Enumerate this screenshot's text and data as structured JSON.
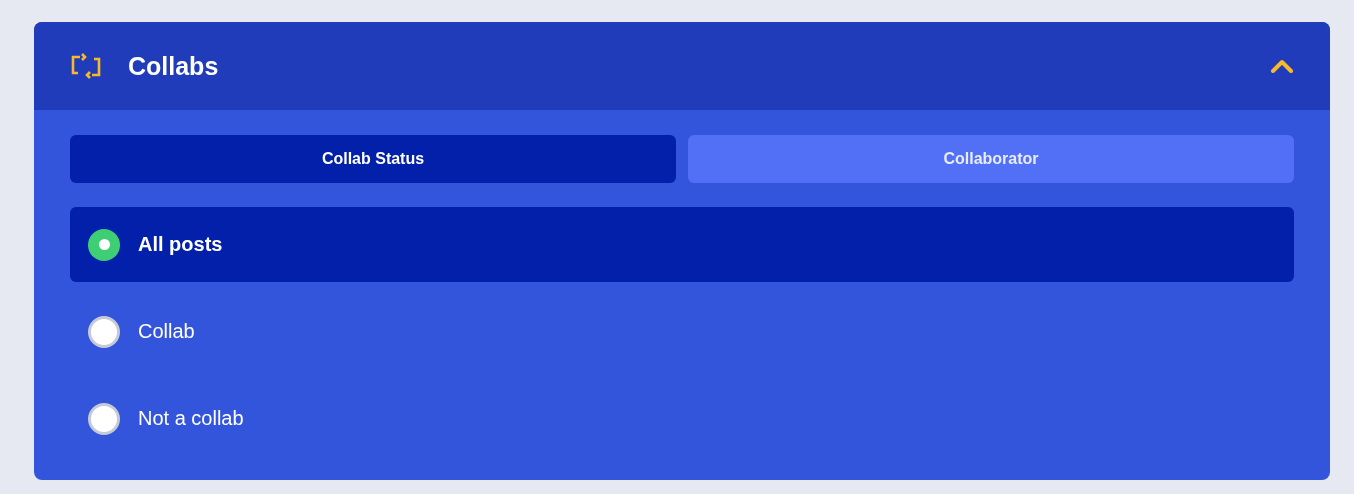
{
  "panel": {
    "title": "Collabs",
    "expanded": true
  },
  "tabs": [
    {
      "label": "Collab Status",
      "selected": true
    },
    {
      "label": "Collaborator",
      "selected": false
    }
  ],
  "options": [
    {
      "label": "All posts",
      "selected": true
    },
    {
      "label": "Collab",
      "selected": false
    },
    {
      "label": "Not a collab",
      "selected": false
    }
  ]
}
